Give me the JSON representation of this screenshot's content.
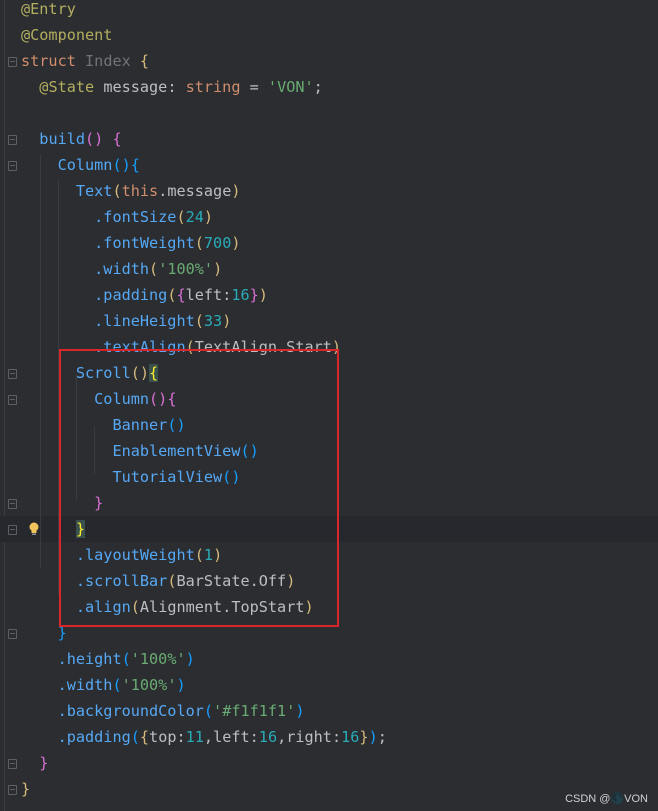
{
  "lines": [
    {
      "fold": false,
      "tokens": [
        [
          "@Entry",
          "ann"
        ]
      ]
    },
    {
      "fold": false,
      "tokens": [
        [
          "@Component",
          "ann"
        ]
      ]
    },
    {
      "fold": true,
      "tokens": [
        [
          "struct",
          "kw"
        ],
        [
          " ",
          "plain"
        ],
        [
          "Index",
          "cls"
        ],
        [
          " ",
          "plain"
        ],
        [
          "{",
          "br1"
        ]
      ]
    },
    {
      "fold": false,
      "tokens": [
        [
          "  ",
          "plain"
        ],
        [
          "@State",
          "ann"
        ],
        [
          " message: ",
          "plain"
        ],
        [
          "string",
          "kw"
        ],
        [
          " = ",
          "plain"
        ],
        [
          "'VON'",
          "str"
        ],
        [
          ";",
          "plain"
        ]
      ]
    },
    {
      "fold": false,
      "tokens": []
    },
    {
      "fold": true,
      "tokens": [
        [
          "  ",
          "plain"
        ],
        [
          "build",
          "fn"
        ],
        [
          "()",
          "br2"
        ],
        [
          " ",
          "plain"
        ],
        [
          "{",
          "br2"
        ]
      ]
    },
    {
      "fold": true,
      "tokens": [
        [
          "    ",
          "plain"
        ],
        [
          "Column",
          "fn"
        ],
        [
          "()",
          "br3"
        ],
        [
          "{",
          "br3"
        ]
      ]
    },
    {
      "fold": false,
      "tokens": [
        [
          "      ",
          "plain"
        ],
        [
          "Text",
          "fn"
        ],
        [
          "(",
          "br1"
        ],
        [
          "this",
          "kw"
        ],
        [
          ".message",
          "plain"
        ],
        [
          ")",
          "br1"
        ]
      ]
    },
    {
      "fold": false,
      "tokens": [
        [
          "        ",
          "plain"
        ],
        [
          ".fontSize",
          "fn"
        ],
        [
          "(",
          "br1"
        ],
        [
          "24",
          "num"
        ],
        [
          ")",
          "br1"
        ]
      ]
    },
    {
      "fold": false,
      "tokens": [
        [
          "        ",
          "plain"
        ],
        [
          ".fontWeight",
          "fn"
        ],
        [
          "(",
          "br1"
        ],
        [
          "700",
          "num"
        ],
        [
          ")",
          "br1"
        ]
      ]
    },
    {
      "fold": false,
      "tokens": [
        [
          "        ",
          "plain"
        ],
        [
          ".width",
          "fn"
        ],
        [
          "(",
          "br1"
        ],
        [
          "'100%'",
          "str"
        ],
        [
          ")",
          "br1"
        ]
      ]
    },
    {
      "fold": false,
      "tokens": [
        [
          "        ",
          "plain"
        ],
        [
          ".padding",
          "fn"
        ],
        [
          "(",
          "br1"
        ],
        [
          "{",
          "br2"
        ],
        [
          "left:",
          "plain"
        ],
        [
          "16",
          "num"
        ],
        [
          "}",
          "br2"
        ],
        [
          ")",
          "br1"
        ]
      ]
    },
    {
      "fold": false,
      "tokens": [
        [
          "        ",
          "plain"
        ],
        [
          ".lineHeight",
          "fn"
        ],
        [
          "(",
          "br1"
        ],
        [
          "33",
          "num"
        ],
        [
          ")",
          "br1"
        ]
      ]
    },
    {
      "fold": false,
      "tokens": [
        [
          "        ",
          "plain"
        ],
        [
          ".textAlign",
          "fn"
        ],
        [
          "(",
          "br1"
        ],
        [
          "TextAlign.Start",
          "plain"
        ],
        [
          ")",
          "br1"
        ]
      ]
    },
    {
      "fold": true,
      "tokens": [
        [
          "      ",
          "plain"
        ],
        [
          "Scroll",
          "fn"
        ],
        [
          "()",
          "br1"
        ],
        [
          "{",
          "hl"
        ]
      ]
    },
    {
      "fold": true,
      "tokens": [
        [
          "        ",
          "plain"
        ],
        [
          "Column",
          "fn"
        ],
        [
          "()",
          "br2"
        ],
        [
          "{",
          "br2"
        ]
      ]
    },
    {
      "fold": false,
      "tokens": [
        [
          "          ",
          "plain"
        ],
        [
          "Banner",
          "fn"
        ],
        [
          "()",
          "br3"
        ]
      ]
    },
    {
      "fold": false,
      "tokens": [
        [
          "          ",
          "plain"
        ],
        [
          "EnablementView",
          "fn"
        ],
        [
          "()",
          "br3"
        ]
      ]
    },
    {
      "fold": false,
      "tokens": [
        [
          "          ",
          "plain"
        ],
        [
          "TutorialView",
          "fn"
        ],
        [
          "()",
          "br3"
        ]
      ]
    },
    {
      "fold": true,
      "tokens": [
        [
          "        ",
          "plain"
        ],
        [
          "}",
          "br2"
        ]
      ]
    },
    {
      "fold": true,
      "current": true,
      "bulb": true,
      "tokens": [
        [
          "      ",
          "plain"
        ],
        [
          "}",
          "hl"
        ]
      ]
    },
    {
      "fold": false,
      "tokens": [
        [
          "      ",
          "plain"
        ],
        [
          ".layoutWeight",
          "fn"
        ],
        [
          "(",
          "br1"
        ],
        [
          "1",
          "num"
        ],
        [
          ")",
          "br1"
        ]
      ]
    },
    {
      "fold": false,
      "tokens": [
        [
          "      ",
          "plain"
        ],
        [
          ".scrollBar",
          "fn"
        ],
        [
          "(",
          "br1"
        ],
        [
          "BarState.Off",
          "plain"
        ],
        [
          ")",
          "br1"
        ]
      ]
    },
    {
      "fold": false,
      "tokens": [
        [
          "      ",
          "plain"
        ],
        [
          ".align",
          "fn"
        ],
        [
          "(",
          "br1"
        ],
        [
          "Alignment.TopStart",
          "plain"
        ],
        [
          ")",
          "br1"
        ]
      ]
    },
    {
      "fold": true,
      "tokens": [
        [
          "    ",
          "plain"
        ],
        [
          "}",
          "br3"
        ]
      ]
    },
    {
      "fold": false,
      "tokens": [
        [
          "    ",
          "plain"
        ],
        [
          ".height",
          "fn"
        ],
        [
          "(",
          "br3"
        ],
        [
          "'100%'",
          "str"
        ],
        [
          ")",
          "br3"
        ]
      ]
    },
    {
      "fold": false,
      "tokens": [
        [
          "    ",
          "plain"
        ],
        [
          ".width",
          "fn"
        ],
        [
          "(",
          "br3"
        ],
        [
          "'100%'",
          "str"
        ],
        [
          ")",
          "br3"
        ]
      ]
    },
    {
      "fold": false,
      "tokens": [
        [
          "    ",
          "plain"
        ],
        [
          ".backgroundColor",
          "fn"
        ],
        [
          "(",
          "br3"
        ],
        [
          "'#f1f1f1'",
          "str"
        ],
        [
          ")",
          "br3"
        ]
      ]
    },
    {
      "fold": false,
      "tokens": [
        [
          "    ",
          "plain"
        ],
        [
          ".padding",
          "fn"
        ],
        [
          "(",
          "br3"
        ],
        [
          "{",
          "br1"
        ],
        [
          "top:",
          "plain"
        ],
        [
          "11",
          "num"
        ],
        [
          ",left:",
          "plain"
        ],
        [
          "16",
          "num"
        ],
        [
          ",right:",
          "plain"
        ],
        [
          "16",
          "num"
        ],
        [
          "}",
          "br1"
        ],
        [
          ")",
          "br3"
        ],
        [
          ";",
          "plain"
        ]
      ]
    },
    {
      "fold": true,
      "tokens": [
        [
          "  ",
          "plain"
        ],
        [
          "}",
          "br2"
        ]
      ]
    },
    {
      "fold": true,
      "tokens": [
        [
          "}",
          "br1"
        ]
      ]
    }
  ],
  "watermark": "CSDN @🌑VON",
  "colors": {
    "background": "#2b2d30",
    "annotation": "#b3ae60",
    "keyword": "#cf8e6d",
    "function": "#56a8f5",
    "number": "#2aacb8",
    "string": "#6aab73",
    "highlight_box": "#d9262b"
  },
  "icons": [
    "fold-icon",
    "lightbulb-icon"
  ]
}
